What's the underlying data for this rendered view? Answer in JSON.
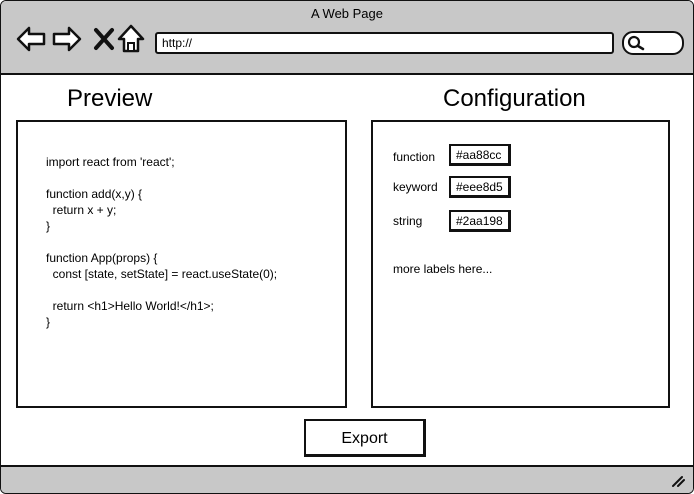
{
  "browser": {
    "title": "A Web Page",
    "url": "http://",
    "icons": [
      "back-arrow-icon",
      "forward-arrow-icon",
      "close-x-icon",
      "home-icon",
      "search-icon",
      "resize-grip-icon"
    ]
  },
  "preview": {
    "heading": "Preview",
    "code": "import react from 'react';\n\nfunction add(x,y) {\n  return x + y;\n}\n\nfunction App(props) {\n  const [state, setState] = react.useState(0);\n\n  return <h1>Hello World!</h1>;\n}"
  },
  "configuration": {
    "heading": "Configuration",
    "items": [
      {
        "label": "function",
        "value": "#aa88cc"
      },
      {
        "label": "keyword",
        "value": "#eee8d5"
      },
      {
        "label": "string",
        "value": "#2aa198"
      }
    ],
    "more": "more labels here..."
  },
  "actions": {
    "export_label": "Export"
  },
  "colors": {
    "chrome": "#c8c8c8",
    "background": "#ffffff",
    "stroke": "#111111"
  }
}
